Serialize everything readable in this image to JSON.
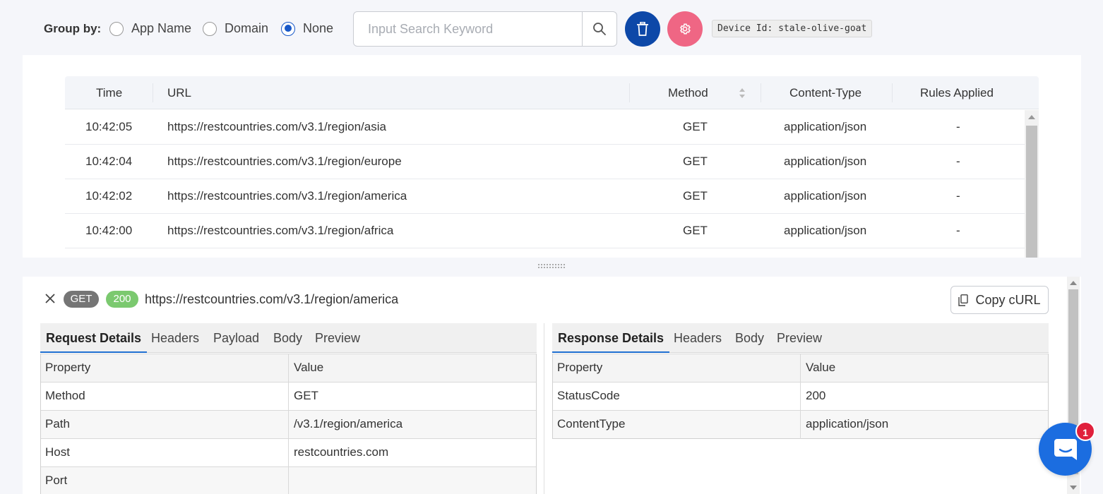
{
  "toolbar": {
    "group_by_label": "Group by:",
    "group_options": [
      {
        "label": "App Name",
        "selected": false
      },
      {
        "label": "Domain",
        "selected": false
      },
      {
        "label": "None",
        "selected": true
      }
    ],
    "search_placeholder": "Input Search Keyword",
    "search_value": "",
    "search_icon": "search-icon",
    "delete_icon": "trash-icon",
    "settings_icon": "gear-icon",
    "device_id": "Device Id: stale-olive-goat"
  },
  "colors": {
    "accent": "#1858c8",
    "delete_button": "#0d48a8",
    "settings_button": "#ef6684",
    "status_badge": "#7bc96f",
    "method_badge": "#757575",
    "chat_launcher": "#1b6de0",
    "notification": "#e0203c"
  },
  "requests": {
    "columns": [
      "Time",
      "URL",
      "Method",
      "Content-Type",
      "Rules Applied"
    ],
    "rows": [
      {
        "time": "10:42:05",
        "url": "https://restcountries.com/v3.1/region/asia",
        "method": "GET",
        "content_type": "application/json",
        "rules": "-"
      },
      {
        "time": "10:42:04",
        "url": "https://restcountries.com/v3.1/region/europe",
        "method": "GET",
        "content_type": "application/json",
        "rules": "-"
      },
      {
        "time": "10:42:02",
        "url": "https://restcountries.com/v3.1/region/america",
        "method": "GET",
        "content_type": "application/json",
        "rules": "-"
      },
      {
        "time": "10:42:00",
        "url": "https://restcountries.com/v3.1/region/africa",
        "method": "GET",
        "content_type": "application/json",
        "rules": "-"
      }
    ]
  },
  "detail": {
    "method": "GET",
    "status": "200",
    "url": "https://restcountries.com/v3.1/region/america",
    "copy_label": "Copy cURL",
    "request": {
      "tabs": [
        "Request Details",
        "Headers",
        "Payload",
        "Body",
        "Preview"
      ],
      "active_tab": "Request Details",
      "header": {
        "key": "Property",
        "value": "Value"
      },
      "rows": [
        {
          "key": "Method",
          "value": "GET"
        },
        {
          "key": "Path",
          "value": "/v3.1/region/america"
        },
        {
          "key": "Host",
          "value": "restcountries.com"
        },
        {
          "key": "Port",
          "value": ""
        }
      ]
    },
    "response": {
      "tabs": [
        "Response Details",
        "Headers",
        "Body",
        "Preview"
      ],
      "active_tab": "Response Details",
      "header": {
        "key": "Property",
        "value": "Value"
      },
      "rows": [
        {
          "key": "StatusCode",
          "value": "200"
        },
        {
          "key": "ContentType",
          "value": "application/json"
        }
      ]
    }
  },
  "chat": {
    "icon": "chat-icon",
    "unread_count": "1"
  }
}
